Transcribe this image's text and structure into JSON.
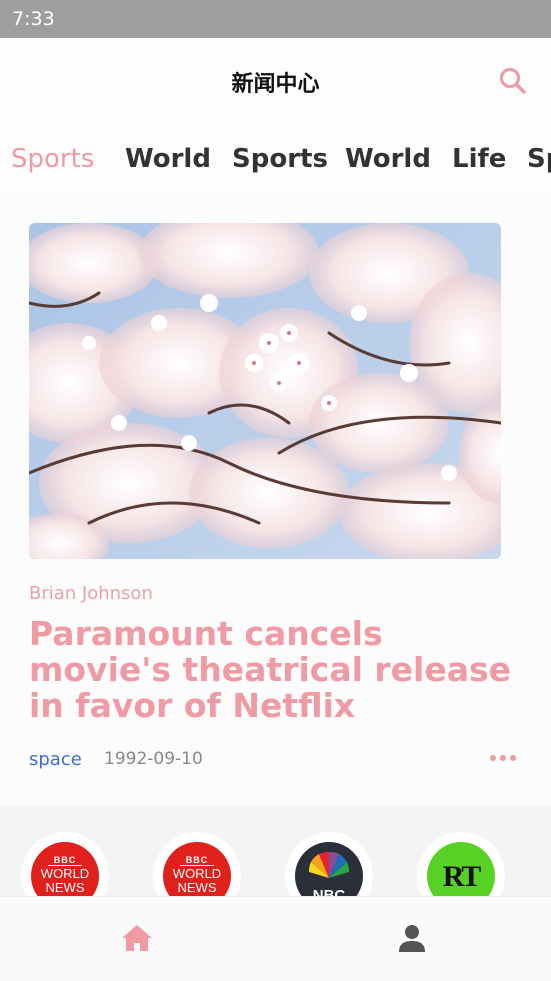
{
  "status_bar": {
    "time": "7:33"
  },
  "header": {
    "title": "新闻中心",
    "search_icon": "search-icon"
  },
  "tabs": [
    {
      "label": "Sports",
      "active": true
    },
    {
      "label": "World",
      "active": false
    },
    {
      "label": "Sports",
      "active": false
    },
    {
      "label": "World",
      "active": false
    },
    {
      "label": "Life",
      "active": false
    },
    {
      "label": "Sports",
      "active": false
    }
  ],
  "article": {
    "image": "cherry-blossom-photo",
    "author": "Brian Johnson",
    "title": "Paramount cancels movie's theatrical release in favor of Netflix",
    "tag": "space",
    "date": "1992-09-10",
    "more_icon": "more-icon"
  },
  "sources": [
    {
      "name": "BBC World News",
      "logo_line1": "BBC",
      "logo_line2": "WORLD",
      "logo_line3": "NEWS"
    },
    {
      "name": "BBC World News",
      "logo_line1": "BBC",
      "logo_line2": "WORLD",
      "logo_line3": "NEWS"
    },
    {
      "name": "NBC",
      "logo_text": "NBC"
    },
    {
      "name": "RT",
      "logo_text": "RT"
    }
  ],
  "bottom_nav": [
    {
      "icon": "home-icon",
      "active": true
    },
    {
      "icon": "profile-icon",
      "active": false
    }
  ],
  "colors": {
    "accent": "#f09aa3",
    "tag_blue": "#3b6fd6",
    "status_bar": "#9e9e9e"
  }
}
